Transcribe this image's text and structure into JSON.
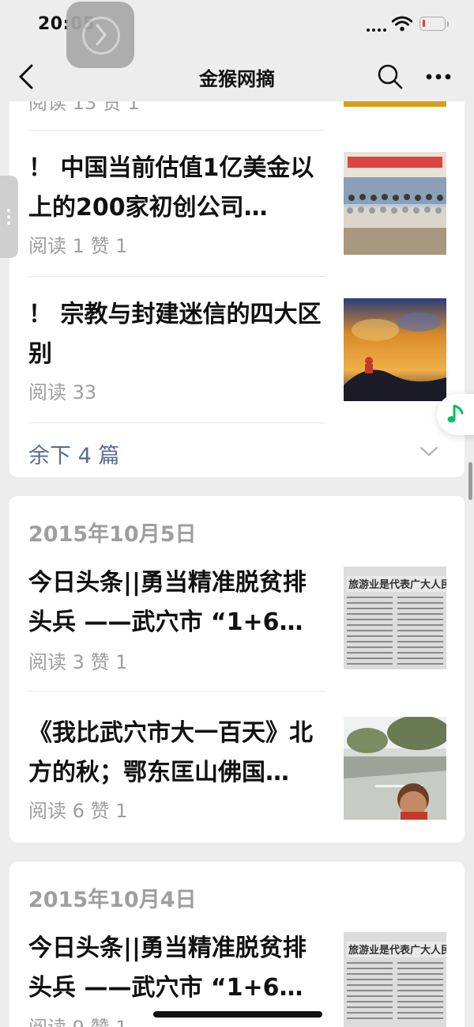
{
  "status_bar": {
    "time": "20:05"
  },
  "nav": {
    "title": "金猴网摘"
  },
  "card1": {
    "partial_meta": "阅读 13  赞 1",
    "items": [
      {
        "title": "！ 中国当前估值1亿美金以上的200家初创公司…",
        "meta": "阅读 1  赞 1"
      },
      {
        "title": "！ 宗教与封建迷信的四大区别",
        "meta": "阅读 33"
      }
    ],
    "more_label": "余下 4 篇"
  },
  "card2": {
    "date": "2015年10月5日",
    "items": [
      {
        "title": "今日头条||勇当精准脱贫排头兵 ——武穴市 “1+6…",
        "meta": "阅读 3  赞 1"
      },
      {
        "title": "《我比武穴市大一百天》北方的秋；鄂东匡山佛国…",
        "meta": "阅读 6  赞 1"
      }
    ]
  },
  "card3": {
    "date": "2015年10月4日",
    "items": [
      {
        "title": "今日头条||勇当精准脱贫排头兵 ——武穴市 “1+6…",
        "meta": "阅读 9  赞 1"
      }
    ]
  },
  "colors": {
    "link": "#576b95",
    "meta": "#9e9e9e",
    "music_green": "#07c160",
    "battery_low": "#e53935"
  },
  "icons": [
    "back-arrow-icon",
    "search-icon",
    "more-icon",
    "chevron-down-icon",
    "music-note-icon",
    "wifi-icon",
    "battery-icon"
  ]
}
